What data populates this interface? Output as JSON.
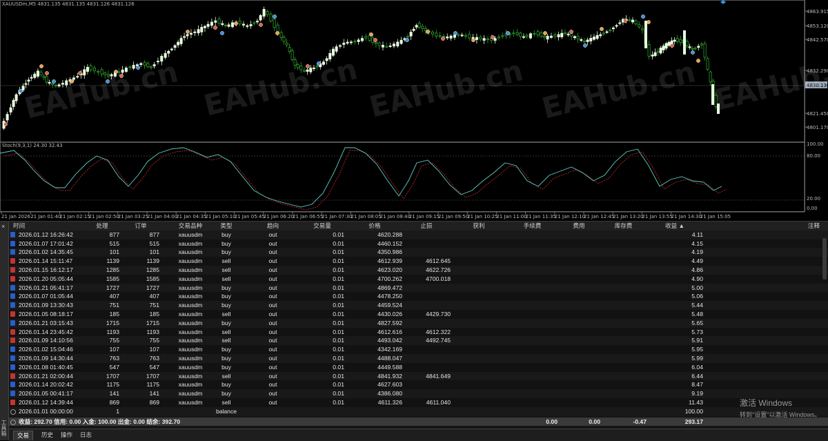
{
  "chart": {
    "header": "XAUUSDm,M5  4831.135 4831.135 4831.126 4831.126",
    "current_price": "4830.130",
    "price_labels": [
      "4863.915",
      "4853.120",
      "4842.570",
      "4832.290",
      "4821.450",
      "4801.170"
    ],
    "indicator_header": "Stoch(9,3,1) 24.30 32.43",
    "indicator_labels": [
      "100.00",
      "80.00",
      "20.00",
      "0.00"
    ],
    "time_labels": [
      "21 Jan 2026",
      "21 Jan 01:40",
      "21 Jan 02:15",
      "21 Jan 02:50",
      "21 Jan 03:25",
      "21 Jan 04:00",
      "21 Jan 04:35",
      "21 Jan 05:10",
      "21 Jan 05:45",
      "21 Jan 06:20",
      "21 Jan 06:55",
      "21 Jan 07:30",
      "21 Jan 08:05",
      "21 Jan 08:40",
      "21 Jan 09:15",
      "21 Jan 09:50",
      "21 Jan 10:25",
      "21 Jan 11:00",
      "21 Jan 11:35",
      "21 Jan 12:10",
      "21 Jan 12:45",
      "21 Jan 13:20",
      "21 Jan 13:55",
      "21 Jan 14:30",
      "21 Jan 15:05"
    ],
    "watermark": "EAHub.cn",
    "colors": {
      "bull": "#e8ffe0",
      "bear": "#2fa02f",
      "stoch_main": "#5bd0c8",
      "stoch_signal": "#c22828"
    }
  },
  "table": {
    "headers": [
      "时间",
      "处理",
      "订单",
      "交易品种",
      "类型",
      "趋向",
      "交易量",
      "价格",
      "止损",
      "获利",
      "手续费",
      "费用",
      "库存费",
      "收益 ▲",
      "注释"
    ],
    "rows": [
      {
        "kind": "buy",
        "time": "2026.01.12 16:26:42",
        "deal": "877",
        "order": "877",
        "symbol": "xauusdm",
        "type": "buy",
        "dir": "out",
        "vol": "0.01",
        "price": "4620.288",
        "sl": "",
        "tp": "",
        "comm": "",
        "fee": "",
        "swap": "",
        "profit": "4.11",
        "comment": ""
      },
      {
        "kind": "buy",
        "time": "2026.01.07 17:01:42",
        "deal": "515",
        "order": "515",
        "symbol": "xauusdm",
        "type": "buy",
        "dir": "out",
        "vol": "0.01",
        "price": "4460.152",
        "sl": "",
        "tp": "",
        "comm": "",
        "fee": "",
        "swap": "",
        "profit": "4.15",
        "comment": ""
      },
      {
        "kind": "buy",
        "time": "2026.01.02 14:35:45",
        "deal": "101",
        "order": "101",
        "symbol": "xauusdm",
        "type": "buy",
        "dir": "out",
        "vol": "0.01",
        "price": "4350.986",
        "sl": "",
        "tp": "",
        "comm": "",
        "fee": "",
        "swap": "",
        "profit": "4.19",
        "comment": ""
      },
      {
        "kind": "sell",
        "time": "2026.01.14 15:11:47",
        "deal": "1139",
        "order": "1139",
        "symbol": "xauusdm",
        "type": "sell",
        "dir": "out",
        "vol": "0.01",
        "price": "4612.939",
        "sl": "4612.645",
        "tp": "",
        "comm": "",
        "fee": "",
        "swap": "",
        "profit": "4.49",
        "comment": ""
      },
      {
        "kind": "sell",
        "time": "2026.01.15 16:12:17",
        "deal": "1285",
        "order": "1285",
        "symbol": "xauusdm",
        "type": "sell",
        "dir": "out",
        "vol": "0.01",
        "price": "4623.020",
        "sl": "4622.726",
        "tp": "",
        "comm": "",
        "fee": "",
        "swap": "",
        "profit": "4.86",
        "comment": ""
      },
      {
        "kind": "sell",
        "time": "2026.01.20 05:05:44",
        "deal": "1585",
        "order": "1585",
        "symbol": "xauusdm",
        "type": "sell",
        "dir": "out",
        "vol": "0.01",
        "price": "4700.262",
        "sl": "4700.018",
        "tp": "",
        "comm": "",
        "fee": "",
        "swap": "",
        "profit": "4.90",
        "comment": ""
      },
      {
        "kind": "buy",
        "time": "2026.01.21 05:41:17",
        "deal": "1727",
        "order": "1727",
        "symbol": "xauusdm",
        "type": "buy",
        "dir": "out",
        "vol": "0.01",
        "price": "4869.472",
        "sl": "",
        "tp": "",
        "comm": "",
        "fee": "",
        "swap": "",
        "profit": "5.00",
        "comment": ""
      },
      {
        "kind": "buy",
        "time": "2026.01.07 01:05:44",
        "deal": "407",
        "order": "407",
        "symbol": "xauusdm",
        "type": "buy",
        "dir": "out",
        "vol": "0.01",
        "price": "4478.250",
        "sl": "",
        "tp": "",
        "comm": "",
        "fee": "",
        "swap": "",
        "profit": "5.06",
        "comment": ""
      },
      {
        "kind": "buy",
        "time": "2026.01.09 13:30:43",
        "deal": "751",
        "order": "751",
        "symbol": "xauusdm",
        "type": "buy",
        "dir": "out",
        "vol": "0.01",
        "price": "4459.524",
        "sl": "",
        "tp": "",
        "comm": "",
        "fee": "",
        "swap": "",
        "profit": "5.44",
        "comment": ""
      },
      {
        "kind": "sell",
        "time": "2026.01.05 08:18:17",
        "deal": "185",
        "order": "185",
        "symbol": "xauusdm",
        "type": "sell",
        "dir": "out",
        "vol": "0.01",
        "price": "4430.026",
        "sl": "4429.730",
        "tp": "",
        "comm": "",
        "fee": "",
        "swap": "",
        "profit": "5.48",
        "comment": ""
      },
      {
        "kind": "buy",
        "time": "2026.01.21 03:15:43",
        "deal": "1715",
        "order": "1715",
        "symbol": "xauusdm",
        "type": "buy",
        "dir": "out",
        "vol": "0.01",
        "price": "4827.592",
        "sl": "",
        "tp": "",
        "comm": "",
        "fee": "",
        "swap": "",
        "profit": "5.65",
        "comment": ""
      },
      {
        "kind": "sell",
        "time": "2026.01.14 23:45:42",
        "deal": "1193",
        "order": "1193",
        "symbol": "xauusdm",
        "type": "sell",
        "dir": "out",
        "vol": "0.01",
        "price": "4612.616",
        "sl": "4612.322",
        "tp": "",
        "comm": "",
        "fee": "",
        "swap": "",
        "profit": "5.73",
        "comment": ""
      },
      {
        "kind": "sell",
        "time": "2026.01.09 14:10:56",
        "deal": "755",
        "order": "755",
        "symbol": "xauusdm",
        "type": "sell",
        "dir": "out",
        "vol": "0.01",
        "price": "4493.042",
        "sl": "4492.745",
        "tp": "",
        "comm": "",
        "fee": "",
        "swap": "",
        "profit": "5.91",
        "comment": ""
      },
      {
        "kind": "buy",
        "time": "2026.01.02 15:04:46",
        "deal": "107",
        "order": "107",
        "symbol": "xauusdm",
        "type": "buy",
        "dir": "out",
        "vol": "0.01",
        "price": "4342.169",
        "sl": "",
        "tp": "",
        "comm": "",
        "fee": "",
        "swap": "",
        "profit": "5.95",
        "comment": ""
      },
      {
        "kind": "buy",
        "time": "2026.01.09 14:30:44",
        "deal": "763",
        "order": "763",
        "symbol": "xauusdm",
        "type": "buy",
        "dir": "out",
        "vol": "0.01",
        "price": "4488.047",
        "sl": "",
        "tp": "",
        "comm": "",
        "fee": "",
        "swap": "",
        "profit": "5.99",
        "comment": ""
      },
      {
        "kind": "buy",
        "time": "2026.01.08 01:40:45",
        "deal": "547",
        "order": "547",
        "symbol": "xauusdm",
        "type": "buy",
        "dir": "out",
        "vol": "0.01",
        "price": "4449.588",
        "sl": "",
        "tp": "",
        "comm": "",
        "fee": "",
        "swap": "",
        "profit": "6.04",
        "comment": ""
      },
      {
        "kind": "sell",
        "time": "2026.01.21 02:00:44",
        "deal": "1707",
        "order": "1707",
        "symbol": "xauusdm",
        "type": "sell",
        "dir": "out",
        "vol": "0.01",
        "price": "4841.932",
        "sl": "4841.649",
        "tp": "",
        "comm": "",
        "fee": "",
        "swap": "",
        "profit": "6.44",
        "comment": ""
      },
      {
        "kind": "buy",
        "time": "2026.01.14 20:02:42",
        "deal": "1175",
        "order": "1175",
        "symbol": "xauusdm",
        "type": "buy",
        "dir": "out",
        "vol": "0.01",
        "price": "4627.603",
        "sl": "",
        "tp": "",
        "comm": "",
        "fee": "",
        "swap": "",
        "profit": "8.47",
        "comment": ""
      },
      {
        "kind": "buy",
        "time": "2026.01.05 00:41:17",
        "deal": "141",
        "order": "141",
        "symbol": "xauusdm",
        "type": "buy",
        "dir": "out",
        "vol": "0.01",
        "price": "4386.080",
        "sl": "",
        "tp": "",
        "comm": "",
        "fee": "",
        "swap": "",
        "profit": "9.19",
        "comment": ""
      },
      {
        "kind": "sell",
        "time": "2026.01.12 14:39:44",
        "deal": "869",
        "order": "869",
        "symbol": "xauusdm",
        "type": "sell",
        "dir": "out",
        "vol": "0.01",
        "price": "4611.326",
        "sl": "4611.040",
        "tp": "",
        "comm": "",
        "fee": "",
        "swap": "",
        "profit": "11.43",
        "comment": ""
      },
      {
        "kind": "bal",
        "time": "2026.01.01 00:00:00",
        "deal": "1",
        "order": "",
        "symbol": "",
        "type": "balance",
        "dir": "",
        "vol": "",
        "price": "",
        "sl": "",
        "tp": "",
        "comm": "",
        "fee": "",
        "swap": "",
        "profit": "100.00",
        "comment": ""
      }
    ],
    "summary": {
      "text": "收益: 292.70  信用: 0.00  入金: 100.00  出金: 0.00  结余: 392.70",
      "comm": "0.00",
      "fee": "0.00",
      "swap": "-0.47",
      "profit": "293.17"
    }
  },
  "tabs": [
    "交易",
    "历史",
    "操作",
    "日志"
  ],
  "side_label": "工具箱",
  "close_glyph": "×",
  "windows_activation": {
    "title": "激活 Windows",
    "subtitle": "转到\"设置\"以激活 Windows。"
  }
}
